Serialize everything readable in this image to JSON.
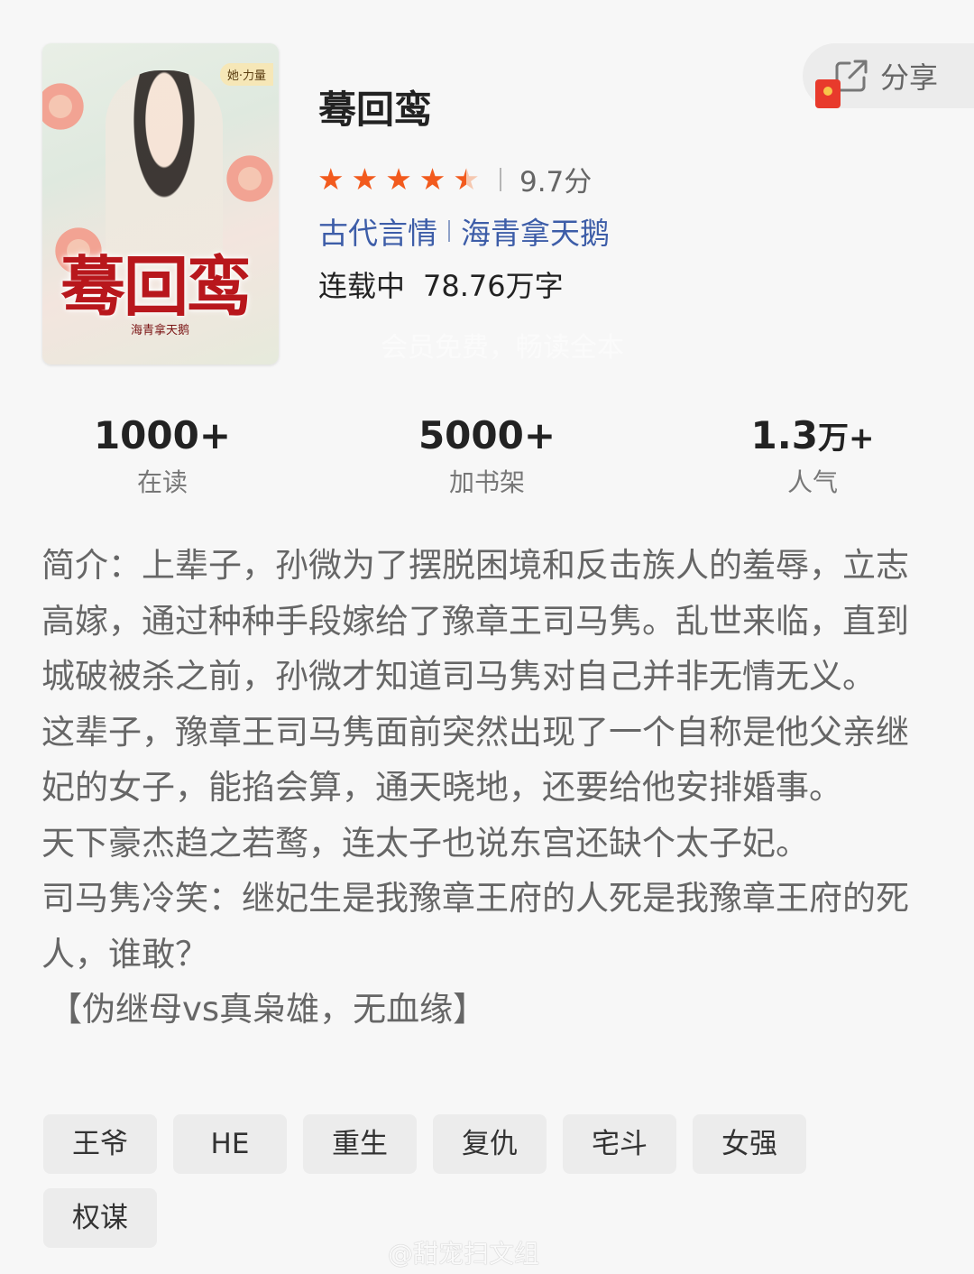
{
  "book": {
    "title": "蓦回鸾",
    "cover": {
      "badge": "她·力量",
      "title": "蓦回鸾",
      "author": "海青拿天鹅"
    },
    "rating": {
      "stars": 4.5,
      "max_stars": 5,
      "score_text": "9.7分"
    },
    "genre": "古代言情",
    "author": "海青拿天鹅",
    "status": "连载中",
    "word_count": "78.76万字",
    "vip_note": "会员免费，畅读全本"
  },
  "share": {
    "label": "分享",
    "icon": "share-icon",
    "gift_icon": "red-packet-icon"
  },
  "stats": [
    {
      "value": "1000+",
      "label": "在读"
    },
    {
      "value": "5000+",
      "label": "加书架"
    },
    {
      "value_num": "1.3",
      "value_unit": "万+",
      "label": "人气"
    }
  ],
  "synopsis": {
    "lines": [
      "简介：上辈子，孙微为了摆脱困境和反击族人的羞辱，立志高嫁，通过种种手段嫁给了豫章王司马隽。乱世来临，直到城破被杀之前，孙微才知道司马隽对自己并非无情无义。",
      "这辈子，豫章王司马隽面前突然出现了一个自称是他父亲继妃的女子，能掐会算，通天晓地，还要给他安排婚事。",
      "天下豪杰趋之若鹜，连太子也说东宫还缺个太子妃。",
      "司马隽冷笑：继妃生是我豫章王府的人死是我豫章王府的死人，谁敢？",
      "【伪继母vs真枭雄，无血缘】"
    ]
  },
  "tags": [
    "王爷",
    "HE",
    "重生",
    "复仇",
    "宅斗",
    "女强",
    "权谋"
  ],
  "watermark": "@甜宠扫文组",
  "colors": {
    "star": "#f25a1d",
    "genre": "#3d5da8",
    "background": "#f7f7f7"
  }
}
